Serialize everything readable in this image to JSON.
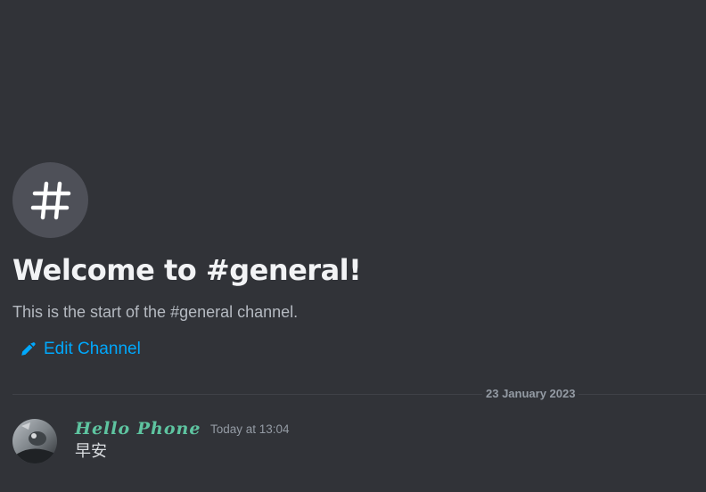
{
  "welcome": {
    "title": "Welcome to #general!",
    "subtitle": "This is the start of the #general channel.",
    "channel_icon": "hash-icon",
    "edit_icon": "pencil-icon",
    "edit_label": "Edit Channel"
  },
  "divider": {
    "date": "23 January 2023"
  },
  "messages": [
    {
      "author": "Hello Phone",
      "timestamp": "Today at 13:04",
      "content": "早安",
      "author_color": "#5ec4a0"
    }
  ],
  "colors": {
    "background": "#313338",
    "link": "#00a8fc",
    "muted": "#949ba4"
  }
}
